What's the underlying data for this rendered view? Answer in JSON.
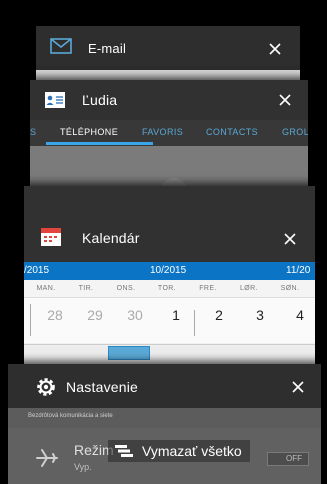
{
  "recent_apps": {
    "email": {
      "title": "E-mail"
    },
    "people": {
      "title": "Ľudia",
      "tabs": [
        "S",
        "TÉLÉPHONE",
        "FAVORIS",
        "CONTACTS",
        "GROL"
      ],
      "active_tab_index": 1
    },
    "calendar": {
      "title": "Kalendár",
      "months": [
        "/2015",
        "10/2015",
        "11/20"
      ],
      "weekdays": [
        "MAN.",
        "TIR.",
        "ONS.",
        "TOR.",
        "FRE.",
        "LØR.",
        "SØN."
      ],
      "days": [
        "28",
        "29",
        "30",
        "1",
        "2",
        "3",
        "4"
      ],
      "muted_days": [
        0,
        1,
        2
      ]
    },
    "settings": {
      "title": "Nastavenie",
      "section_header": "Bezdrôtová komunikácia a siete",
      "row_title": "Režim",
      "row_subtitle": "Vyp.",
      "toggle_label": "OFF"
    }
  },
  "clear_all": {
    "label": "Vymazať všetko"
  },
  "colors": {
    "accent": "#3aa5e8",
    "calendar_bar": "#0b74c4",
    "header": "#313131"
  },
  "icons": [
    "email-icon",
    "contacts-icon",
    "calendar-icon",
    "gear-icon",
    "airplane-icon",
    "close-icon",
    "clear-all-icon"
  ]
}
